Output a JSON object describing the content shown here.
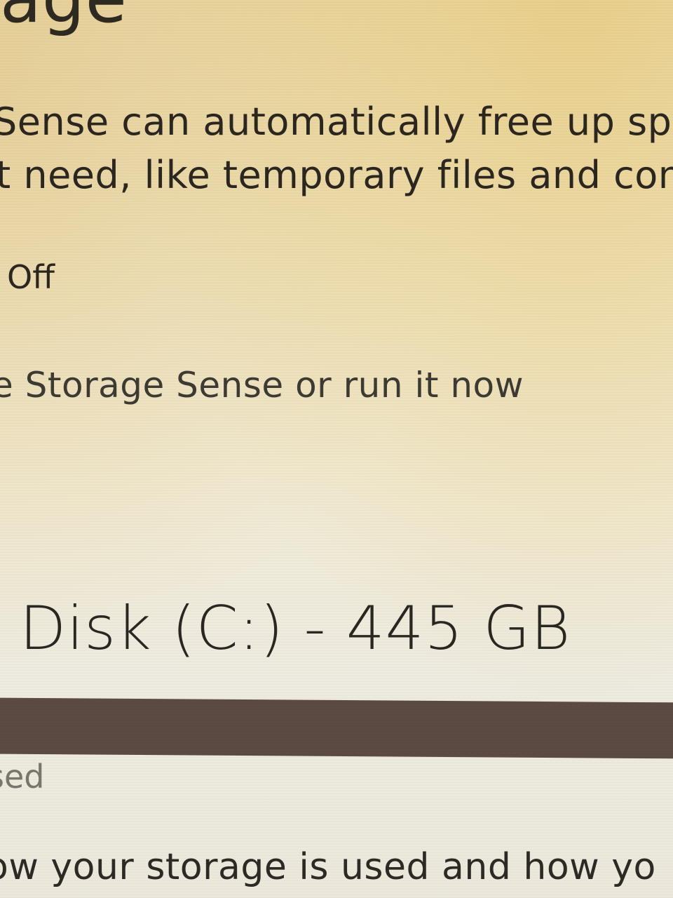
{
  "page": {
    "heading_fragment": "age"
  },
  "storage_sense": {
    "description_line1": "Sense can automatically free up spa",
    "description_line2": "t need, like temporary files and con",
    "toggle_state": "Off",
    "configure_link": "e Storage Sense or run it now"
  },
  "disk": {
    "title": "Disk (C:) - 445 GB",
    "used_label": "sed",
    "footer_text": "ow your storage is used and how yo",
    "colors": {
      "bar_fill": "#5c4b43",
      "bar_track": "#dcd8ce"
    },
    "used_fraction": 1.0
  }
}
